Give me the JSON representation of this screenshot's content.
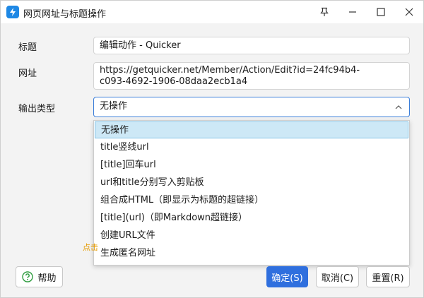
{
  "window": {
    "title": "网页网址与标题操作"
  },
  "form": {
    "title_label": "标题",
    "title_value": "编辑动作 - Quicker",
    "url_label": "网址",
    "url_value_line1": "https://getquicker.net/Member/Action/Edit?id=24fc94b4-",
    "url_value_line2": "c093-4692-1906-08daa2ecb1a4",
    "output_label": "输出类型",
    "output_selected": "无操作"
  },
  "dropdown": {
    "options": [
      "无操作",
      "title竖线url",
      "[title]回车url",
      "url和title分别写入剪贴板",
      "组合成HTML（即显示为标题的超链接）",
      "[title](url)（即Markdown超链接）",
      "创建URL文件",
      "生成匿名网址"
    ]
  },
  "hint": "点击",
  "buttons": {
    "help": "帮助",
    "ok": "确定(S)",
    "cancel": "取消(C)",
    "reset": "重置(R)"
  },
  "colors": {
    "accent": "#2f6fde",
    "selected_bg": "#cde8f6",
    "hint": "#e69b00"
  }
}
